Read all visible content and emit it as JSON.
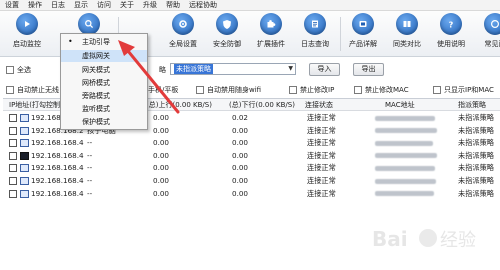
{
  "menu": [
    "设置",
    "操作",
    "日志",
    "显示",
    "访问",
    "关于",
    "升级",
    "帮助",
    "远程协助"
  ],
  "toolbar": [
    {
      "label": "启动监控",
      "icon": "play-icon",
      "color": "#2d73c8"
    },
    {
      "label": "全局设置",
      "icon": "gear-icon",
      "color": "#2d73c8"
    },
    {
      "label": "安全防御",
      "icon": "shield-icon",
      "color": "#2d73c8"
    },
    {
      "label": "扩展插件",
      "icon": "puzzle-icon",
      "color": "#2d73c8"
    },
    {
      "label": "日志查询",
      "icon": "log-icon",
      "color": "#2d73c8"
    },
    {
      "label": "产品详解",
      "icon": "product-icon",
      "color": "#2d73c8"
    },
    {
      "label": "同类对比",
      "icon": "compare-icon",
      "color": "#2d73c8"
    },
    {
      "label": "使用说明",
      "icon": "help-icon",
      "color": "#2d73c8"
    },
    {
      "label": "常见问",
      "icon": "faq-icon",
      "color": "#2d73c8"
    }
  ],
  "filter": {
    "select_all": "全选",
    "strategy_label": "略",
    "strategy_value": "未指派策略",
    "import_label": "导入",
    "export_label": "导出"
  },
  "options": {
    "auto_block_wireless": "自动禁止无线",
    "phone_tablet": "手机/平板",
    "auto_disable_wifi": "自动禁用随身wifi",
    "forbid_modify_ip": "禁止修改IP",
    "forbid_modify_mac": "禁止修改MAC",
    "only_show_ip_mac": "只显示IP和MAC"
  },
  "table": {
    "headers": [
      "IP地址(打勾控制)",
      "(总)上行(0.00 KB/S)",
      "(总)下行(0.00 KB/S)",
      "连接状态",
      "MAC地址",
      "指派策略"
    ],
    "rows": [
      {
        "ip": "192.168.168.",
        "name": "",
        "up": "0.00",
        "down": "0.02",
        "status": "连接正常",
        "strategy": "未指派策略"
      },
      {
        "ip": "192.168.168.2",
        "name": "孩子电脑",
        "up": "0.00",
        "down": "0.00",
        "status": "连接正常",
        "strategy": "未指派策略"
      },
      {
        "ip": "192.168.168.4",
        "name": "--",
        "up": "0.00",
        "down": "0.00",
        "status": "连接正常",
        "strategy": "未指派策略"
      },
      {
        "ip": "192.168.168.4",
        "name": "--",
        "up": "0.00",
        "down": "0.00",
        "status": "连接正常",
        "strategy": "未指派策略"
      },
      {
        "ip": "192.168.168.4",
        "name": "--",
        "up": "0.00",
        "down": "0.00",
        "status": "连接正常",
        "strategy": "未指派策略"
      },
      {
        "ip": "192.168.168.4",
        "name": "--",
        "up": "0.00",
        "down": "0.00",
        "status": "连接正常",
        "strategy": "未指派策略"
      },
      {
        "ip": "192.168.168.4",
        "name": "--",
        "up": "0.00",
        "down": "0.00",
        "status": "连接正常",
        "strategy": "未指派策略"
      }
    ]
  },
  "dropdown": {
    "items": [
      "主动引导",
      "虚拟网关",
      "网关模式",
      "网桥模式",
      "旁路模式",
      "监听模式",
      "保护模式"
    ],
    "selected": "主动引导",
    "highlighted": "虚拟网关"
  },
  "colors": {
    "accent": "#2d73c8",
    "selection": "#3875d7",
    "annotation": "#e23b3b"
  }
}
